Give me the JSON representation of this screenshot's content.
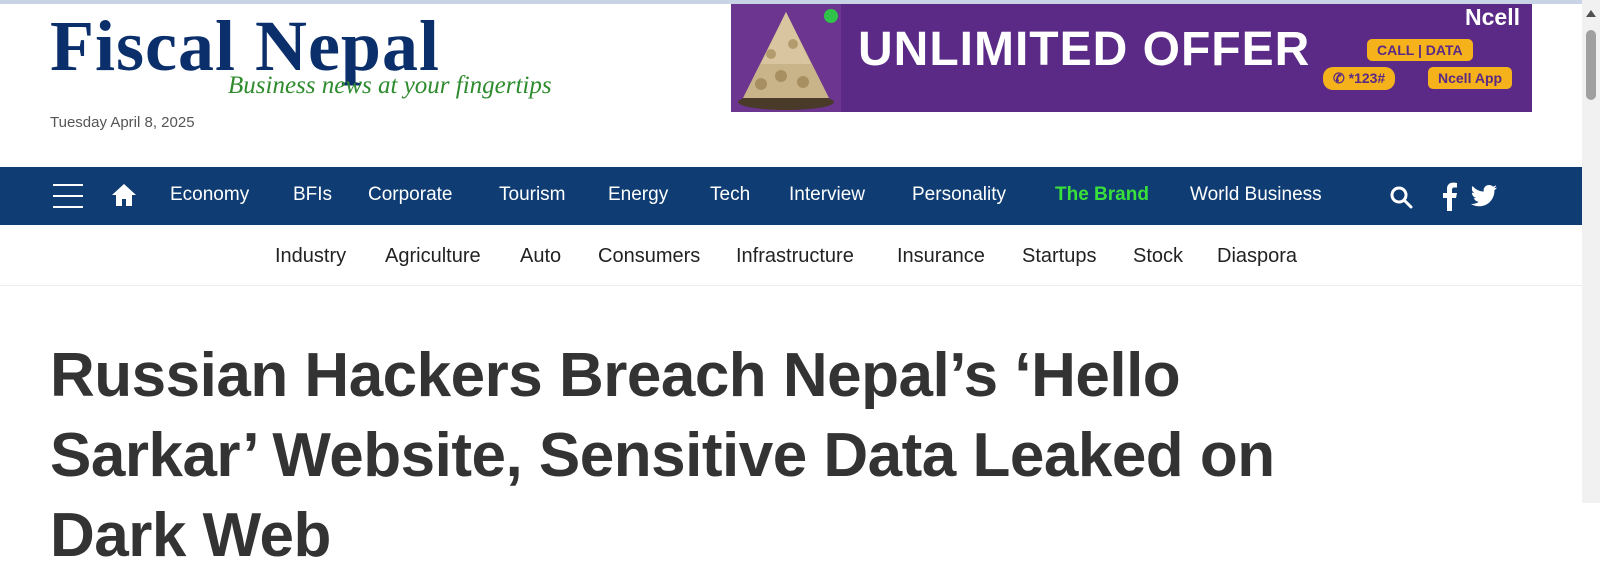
{
  "header": {
    "logo_title": "Fiscal Nepal",
    "tagline": "Business news at your fingertips",
    "date": "Tuesday April 8, 2025"
  },
  "ad": {
    "title": "UNLIMITED OFFER",
    "brand": "Ncell",
    "call_data": "CALL | DATA",
    "code": "✆ *123#",
    "app": "Ncell App",
    "background": "#5a2a86",
    "accent": "#f5b21a"
  },
  "main_nav": {
    "background": "#0f3d73",
    "items": [
      {
        "label": "Economy"
      },
      {
        "label": "BFIs"
      },
      {
        "label": "Corporate"
      },
      {
        "label": "Tourism"
      },
      {
        "label": "Energy"
      },
      {
        "label": "Tech"
      },
      {
        "label": "Interview"
      },
      {
        "label": "Personality"
      },
      {
        "label": "The Brand",
        "highlight": "#39e03a"
      },
      {
        "label": "World Business"
      }
    ],
    "icons": [
      "menu-icon",
      "home-icon",
      "search-icon",
      "facebook-icon",
      "twitter-icon"
    ]
  },
  "sub_nav": {
    "items": [
      {
        "label": "Industry"
      },
      {
        "label": "Agriculture"
      },
      {
        "label": "Auto"
      },
      {
        "label": "Consumers"
      },
      {
        "label": "Infrastructure"
      },
      {
        "label": "Insurance"
      },
      {
        "label": "Startups"
      },
      {
        "label": "Stock"
      },
      {
        "label": "Diaspora"
      }
    ]
  },
  "article": {
    "headline": "Russian Hackers Breach Nepal’s ‘Hello Sarkar’ Website, Sensitive Data Leaked on Dark Web"
  }
}
